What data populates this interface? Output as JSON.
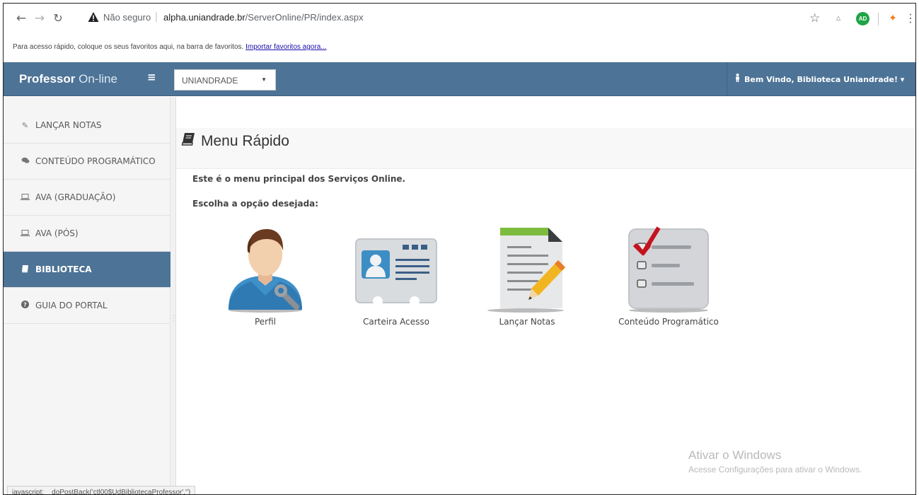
{
  "browser": {
    "security_label": "Não seguro",
    "url_separator": "|",
    "url_domain": "alpha.uniandrade.br",
    "url_path": "/ServerOnline/PR/index.aspx",
    "bookmark_hint": "Para acesso rápido, coloque os seus favoritos aqui, na barra de favoritos.",
    "bookmark_link": "Importar favoritos agora...",
    "extension_badge": "AD",
    "status_text": "javascript:__doPostBack('ctl00$UdBibliotecaProfessor','')"
  },
  "topnav": {
    "brand_bold": "Professor",
    "brand_rest": "On-line",
    "institution_selected": "UNIANDRADE",
    "welcome_text": "Bem Vindo, Biblioteca Uniandrade! ▾"
  },
  "sidebar": {
    "items": [
      {
        "label": "LANÇAR NOTAS",
        "icon": "pencil-icon"
      },
      {
        "label": "CONTEÚDO PROGRAMÁTICO",
        "icon": "comments-icon"
      },
      {
        "label": "AVA (GRADUAÇÃO)",
        "icon": "laptop-icon"
      },
      {
        "label": "AVA (PÓS)",
        "icon": "laptop-icon"
      },
      {
        "label": "BIBLIOTECA",
        "icon": "book-icon",
        "active": true
      },
      {
        "label": "GUIA DO PORTAL",
        "icon": "question-circle-icon"
      }
    ]
  },
  "main": {
    "title": "Menu Rápido",
    "intro": "Este é o menu principal dos Serviços Online.",
    "choose": "Escolha a opção desejada:",
    "tiles": [
      {
        "label": "Perfil",
        "icon": "profile-icon"
      },
      {
        "label": "Carteira Acesso",
        "icon": "id-card-icon"
      },
      {
        "label": "Lançar Notas",
        "icon": "notes-document-icon"
      },
      {
        "label": "Conteúdo Programático",
        "icon": "checklist-icon"
      }
    ]
  },
  "watermark": {
    "line1": "Ativar o Windows",
    "line2": "Acesse Configurações para ativar o Windows."
  },
  "colors": {
    "nav_blue": "#4d7396",
    "active_item": "#4d7396",
    "checkmark_red": "#c4131e"
  }
}
